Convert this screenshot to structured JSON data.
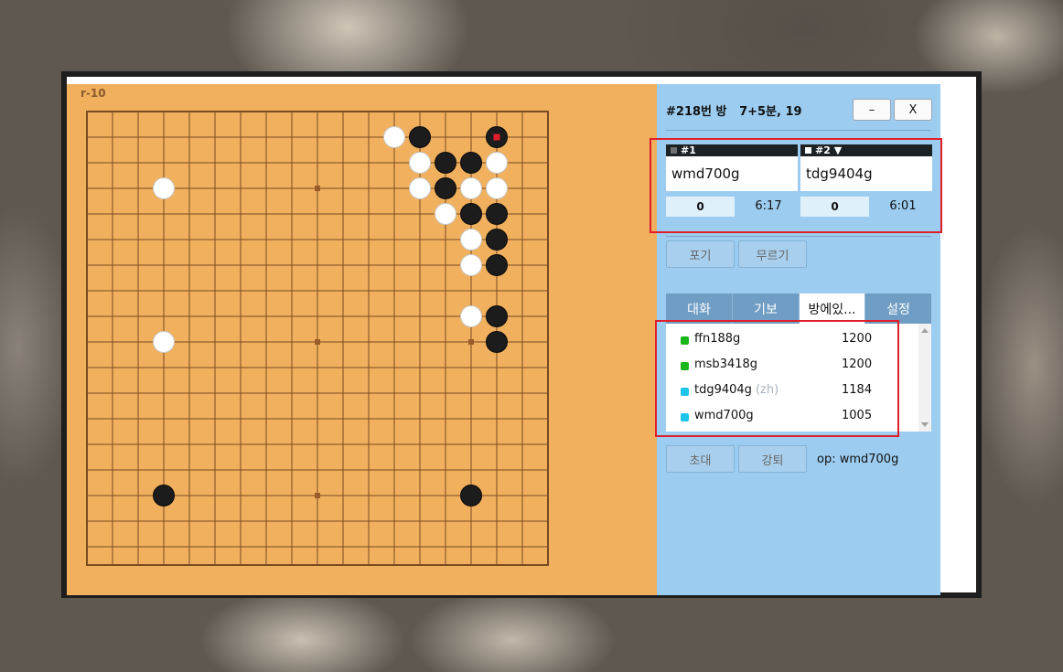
{
  "board": {
    "move_label": "r-10",
    "size": 19,
    "last_move": [
      16,
      1
    ],
    "stones": {
      "black": [
        [
          13,
          1
        ],
        [
          16,
          1
        ],
        [
          14,
          2
        ],
        [
          15,
          2
        ],
        [
          14,
          3
        ],
        [
          15,
          4
        ],
        [
          16,
          4
        ],
        [
          16,
          5
        ],
        [
          16,
          6
        ],
        [
          16,
          8
        ],
        [
          16,
          9
        ],
        [
          3,
          15
        ],
        [
          15,
          15
        ]
      ],
      "white": [
        [
          12,
          1
        ],
        [
          13,
          2
        ],
        [
          16,
          2
        ],
        [
          3,
          3
        ],
        [
          13,
          3
        ],
        [
          15,
          3
        ],
        [
          16,
          3
        ],
        [
          14,
          4
        ],
        [
          15,
          5
        ],
        [
          15,
          6
        ],
        [
          15,
          8
        ],
        [
          3,
          9
        ]
      ]
    },
    "colors": {
      "board": "#f0b05e",
      "line": "#7a4a22",
      "last_move_marker": "#e01e2a"
    }
  },
  "room": {
    "title": "#218번 방",
    "settings": "7+5분, 19",
    "minimize_label": "–",
    "close_label": "X"
  },
  "players": [
    {
      "header": "#1",
      "name": "wmd700g",
      "score": "0",
      "time": "6:17",
      "stone": "black"
    },
    {
      "header": "#2 ▼",
      "name": "tdg9404g",
      "score": "0",
      "time": "6:01",
      "stone": "white"
    }
  ],
  "actions": {
    "resign": "포기",
    "undo": "무르기"
  },
  "tabs": [
    {
      "label": "대화",
      "active": false
    },
    {
      "label": "기보",
      "active": false
    },
    {
      "label": "방에있...",
      "active": true
    },
    {
      "label": "설정",
      "active": false
    }
  ],
  "users": [
    {
      "name": "ffn188g",
      "lang": "",
      "rating": "1200",
      "color": "#19b51a"
    },
    {
      "name": "msb3418g",
      "lang": "",
      "rating": "1200",
      "color": "#19b51a"
    },
    {
      "name": "tdg9404g",
      "lang": "(zh)",
      "rating": "1184",
      "color": "#1ec4ea"
    },
    {
      "name": "wmd700g",
      "lang": "",
      "rating": "1005",
      "color": "#1ec4ea"
    }
  ],
  "footer": {
    "invite": "초대",
    "kick": "강퇴",
    "op": "op: wmd700g"
  }
}
